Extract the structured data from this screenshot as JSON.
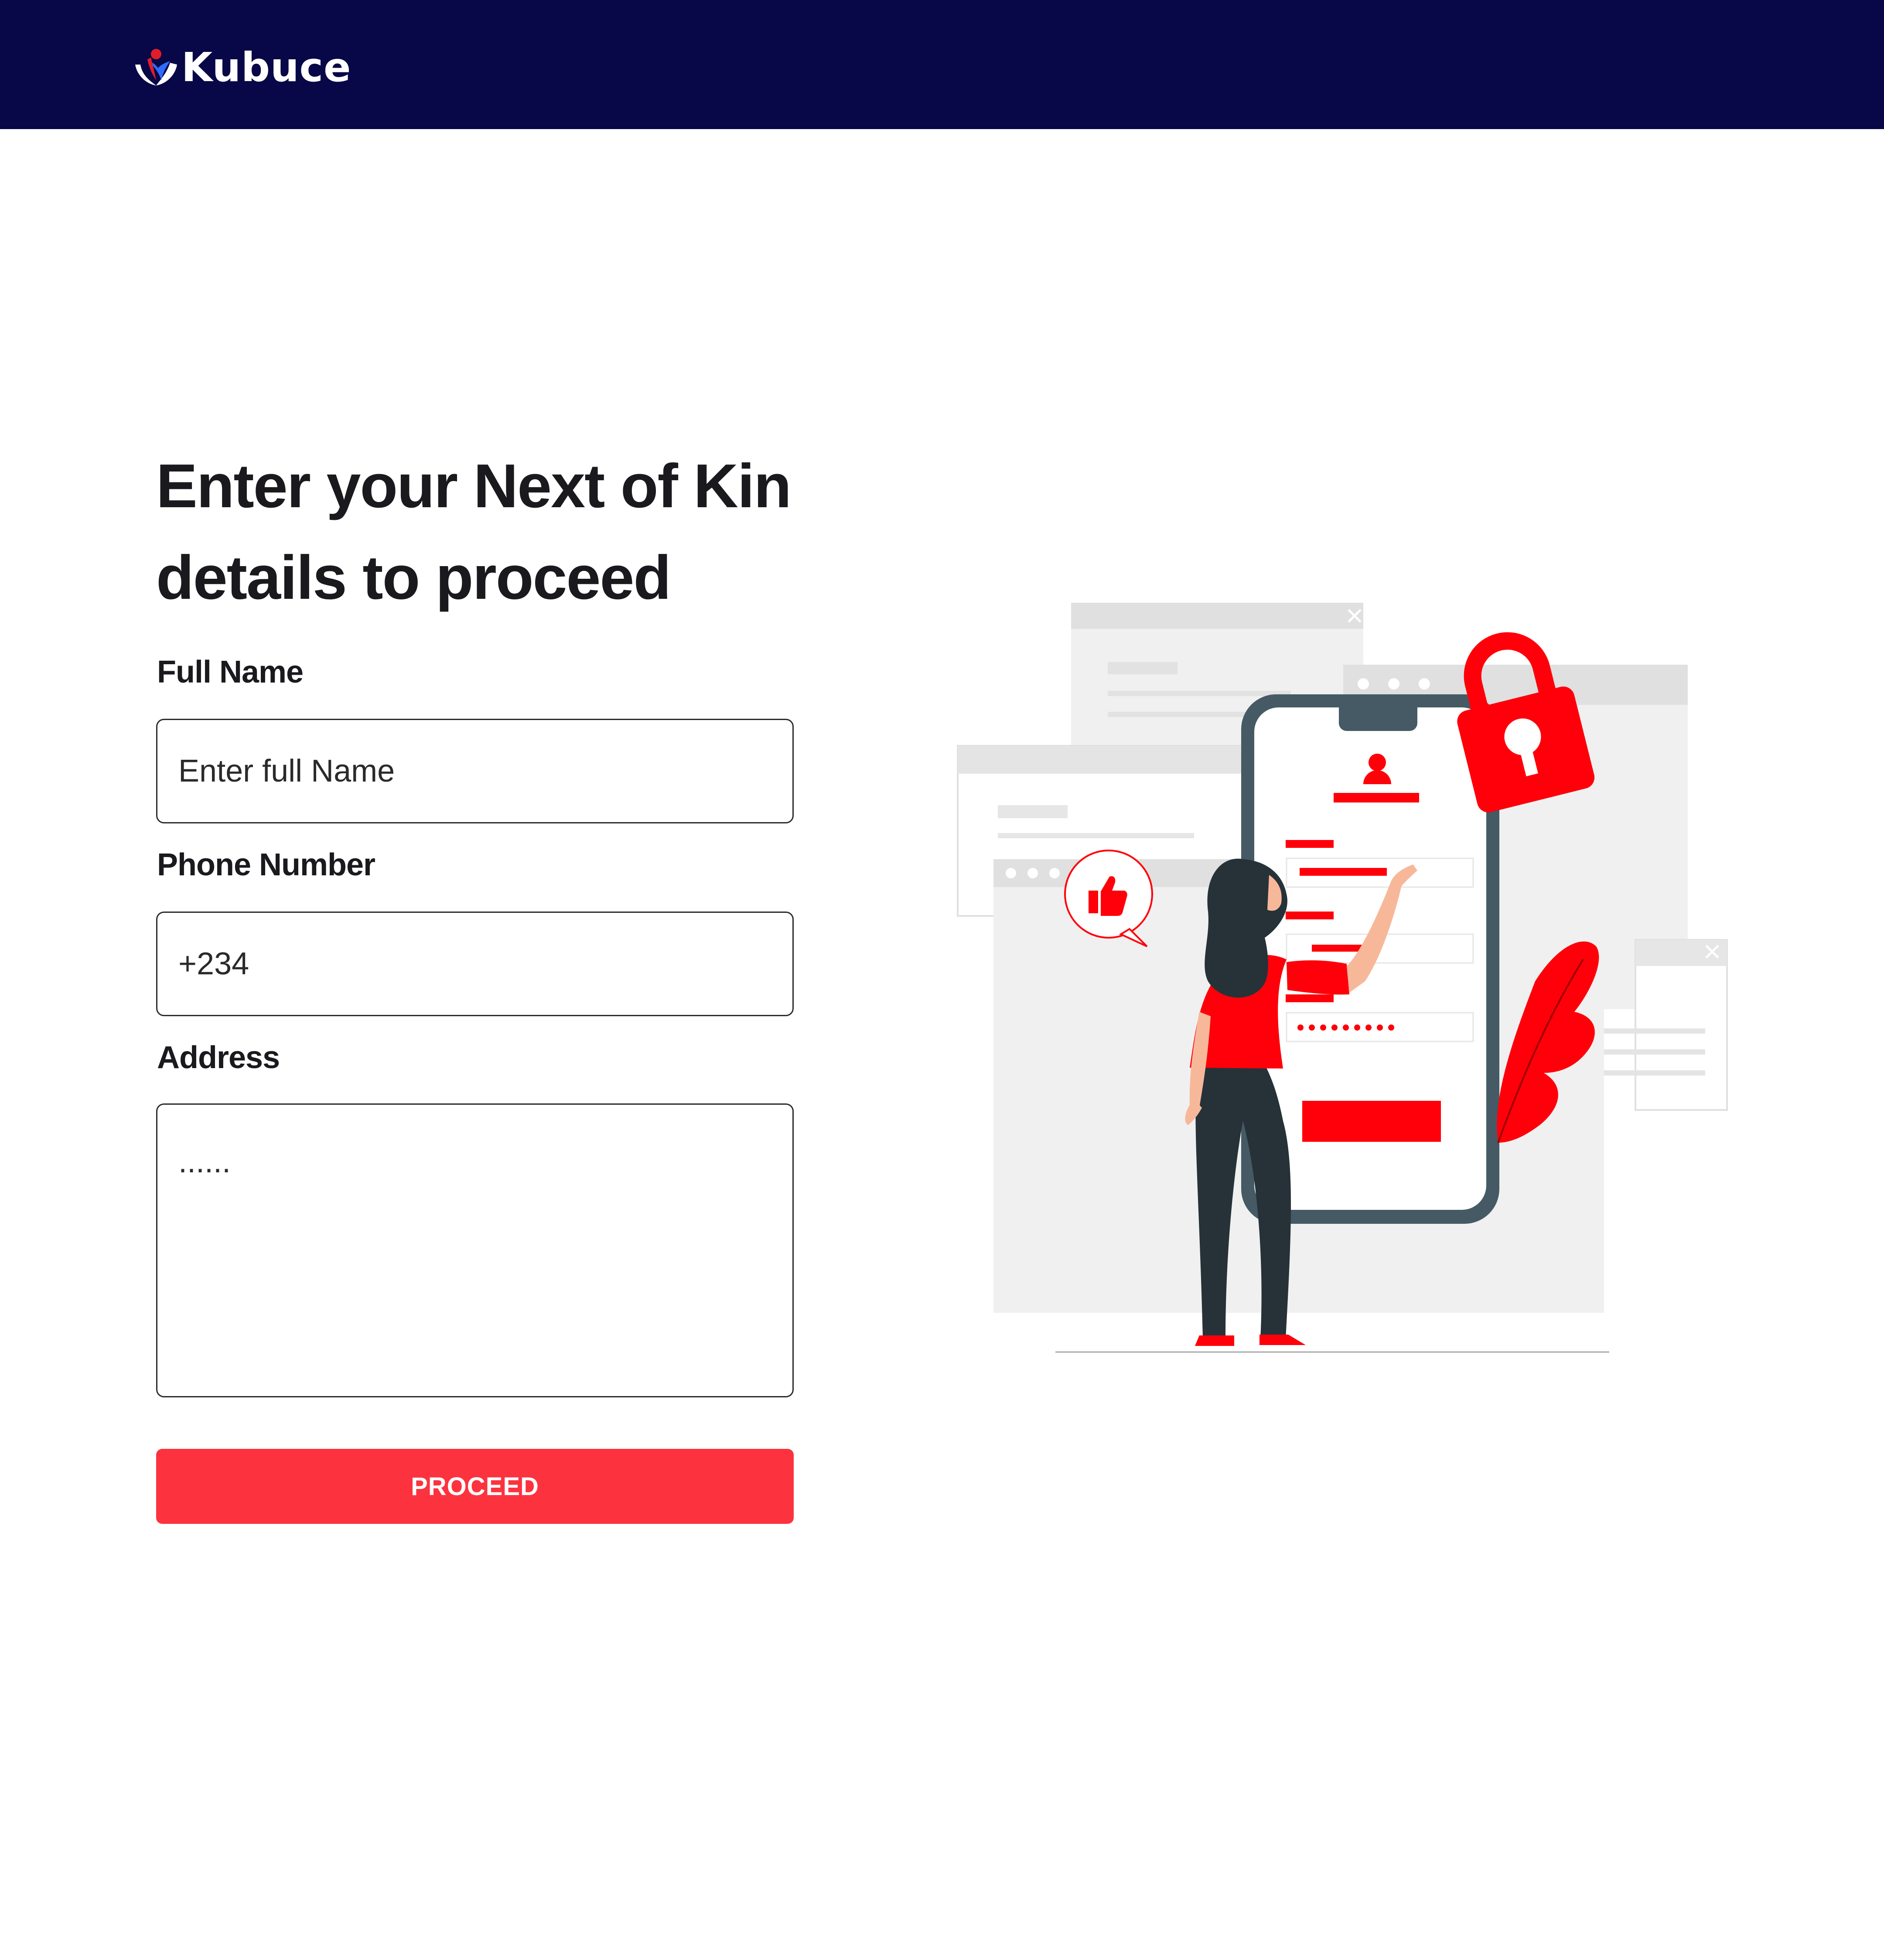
{
  "header": {
    "brand": "Kubuce",
    "background_color": "#080748"
  },
  "main": {
    "heading_line1": "Enter your Next of Kin",
    "heading_line2": "details to proceed",
    "full_name": {
      "label": "Full Name",
      "placeholder": "Enter full Name",
      "value": ""
    },
    "phone": {
      "label": "Phone Number",
      "placeholder": "+234",
      "value": ""
    },
    "address": {
      "label": "Address",
      "placeholder": "......",
      "value": ""
    },
    "proceed_label": "PROCEED",
    "accent_color": "#fc333e"
  },
  "illustration": {
    "icon": "woman-filling-secure-mobile-form-illustration"
  }
}
